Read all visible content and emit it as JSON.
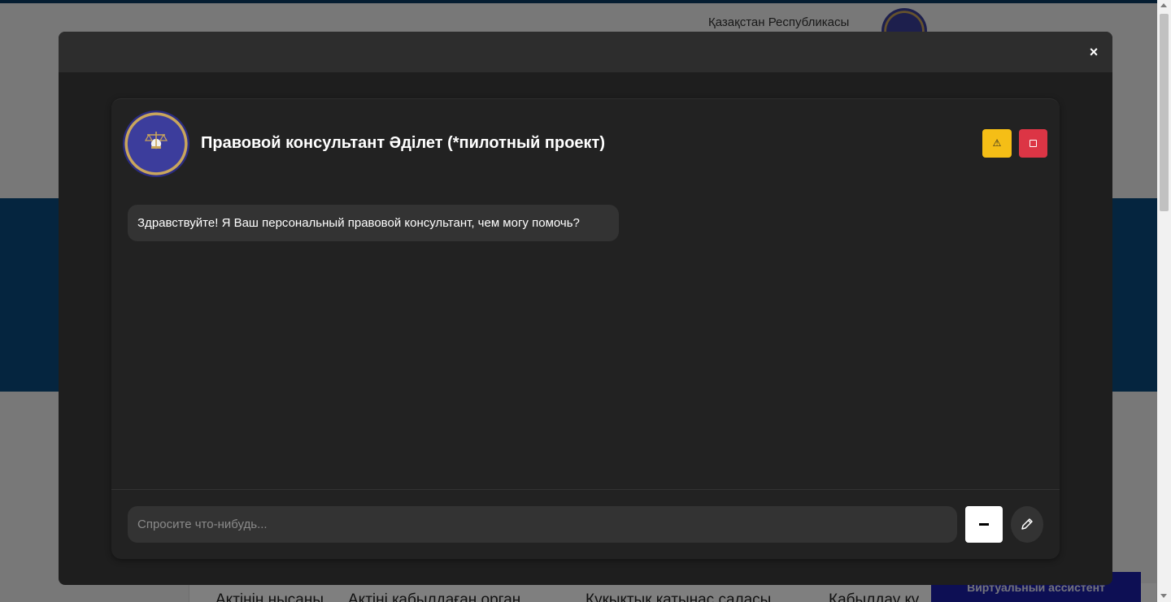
{
  "background_page": {
    "header_text": "Қазақстан Республикасы",
    "tabs": [
      "Актінің нысаны",
      "Актіні қабылдаған орган",
      "Құқықтық қатынас саласы",
      "Қабылдау кү"
    ],
    "assistant_button": "Виртуальный ассистент"
  },
  "modal": {
    "close_label": "×"
  },
  "chat": {
    "title": "Правовой консультант Әділет (*пилотный проект)",
    "warning_label": "⚠",
    "messages": [
      {
        "from": "bot",
        "text": "Здравствуйте! Я Ваш персональный правовой консультант, чем могу помочь?"
      }
    ],
    "input": {
      "value": "",
      "placeholder": "Спросите что-нибудь..."
    }
  },
  "colors": {
    "warning": "#f5be16",
    "danger": "#dc3545",
    "modal_bg": "#1e1e1e",
    "chat_bg": "#222222",
    "bubble_bg": "#333333"
  },
  "icons": [
    "emblem-icon",
    "warning-icon",
    "stop-icon",
    "close-icon",
    "send-icon",
    "pencil-icon"
  ]
}
